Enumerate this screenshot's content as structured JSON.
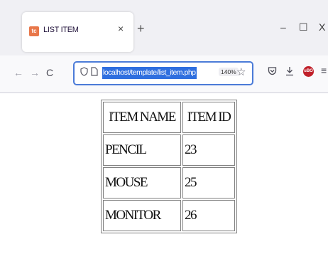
{
  "browser": {
    "tab": {
      "favicon_label": "tc",
      "title": "LIST ITEM",
      "close_glyph": "×"
    },
    "new_tab_glyph": "+",
    "window_controls": {
      "minimize": "–",
      "maximize": "☐",
      "close": "X"
    },
    "nav": {
      "back": "←",
      "forward": "→",
      "reload": "C"
    },
    "url": {
      "text": "localhost/template/list_item.php",
      "zoom": "140%"
    },
    "toolbar_icons": [
      "pocket-icon",
      "download-icon",
      "ublock-icon",
      "menu-icon"
    ],
    "extension_badge": "uBO"
  },
  "table": {
    "headers": [
      "ITEM NAME",
      "ITEM ID"
    ],
    "rows": [
      {
        "name": "PENCIL",
        "id": "23"
      },
      {
        "name": "MOUSE",
        "id": "25"
      },
      {
        "name": "MONITOR",
        "id": "26"
      }
    ]
  },
  "colors": {
    "accent": "#2f6fdf",
    "urlbar_border": "#4b7bd8",
    "tabstrip_bg": "#f0f0f4",
    "extension_red": "#c0202a"
  }
}
